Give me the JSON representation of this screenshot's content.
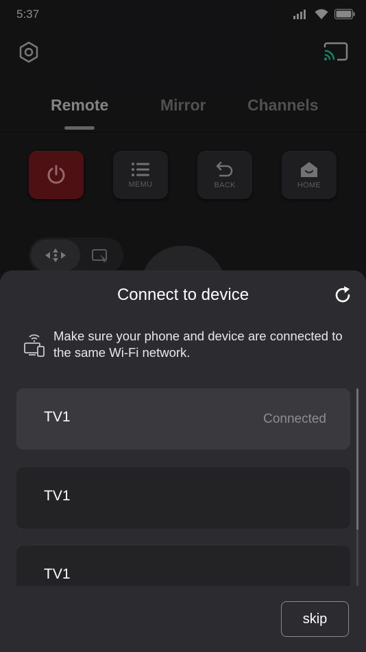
{
  "status_bar": {
    "time": "5:37",
    "icons": [
      "signal-icon",
      "wifi-icon",
      "battery-icon"
    ]
  },
  "header": {
    "settings_icon": "settings-icon",
    "cast_icon": "cast-icon"
  },
  "tabs": [
    {
      "label": "Remote",
      "active": true
    },
    {
      "label": "Mirror",
      "active": false
    },
    {
      "label": "Channels",
      "active": false
    }
  ],
  "remote_buttons": {
    "power_icon": "power-icon",
    "menu_label": "MEMU",
    "back_label": "BACK",
    "home_label": "HOME"
  },
  "colors": {
    "power": "#7a1a20",
    "cast_accent": "#1fc7a0",
    "sheet_bg": "#2c2c30",
    "selected_item": "#3a3a3e"
  },
  "sheet": {
    "title": "Connect to device",
    "hint": "Make sure your phone and device are connected to the same Wi-Fi network.",
    "devices": [
      {
        "name": "TV1",
        "status": "Connected"
      },
      {
        "name": "TV1",
        "status": ""
      },
      {
        "name": "TV1",
        "status": ""
      }
    ],
    "skip_label": "skip"
  }
}
